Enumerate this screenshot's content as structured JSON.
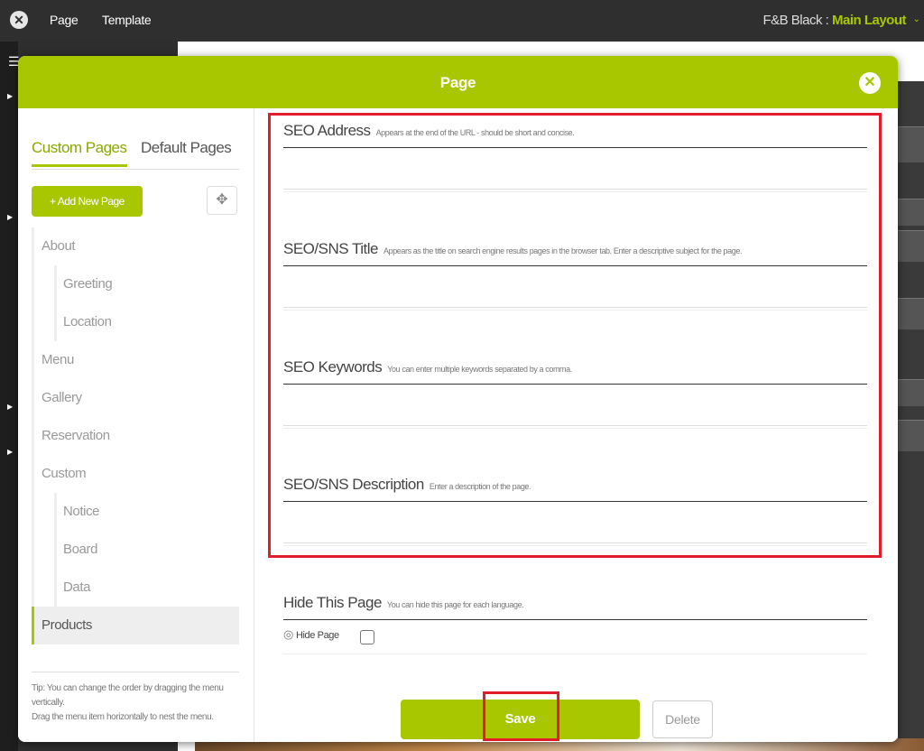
{
  "topbar": {
    "tab_page": "Page",
    "tab_template": "Template",
    "layout_prefix": "F&B Black : ",
    "layout_name": "Main Layout"
  },
  "modal": {
    "title": "Page",
    "close_glyph": "✕"
  },
  "left_panel": {
    "tab_custom": "Custom Pages",
    "tab_default": "Default Pages",
    "add_button": "+ Add New Page",
    "items": [
      {
        "label": "About",
        "level": 0
      },
      {
        "label": "Greeting",
        "level": 1
      },
      {
        "label": "Location",
        "level": 1
      },
      {
        "label": "Menu",
        "level": 0
      },
      {
        "label": "Gallery",
        "level": 0
      },
      {
        "label": "Reservation",
        "level": 0
      },
      {
        "label": "Custom",
        "level": 0
      },
      {
        "label": "Notice",
        "level": 1
      },
      {
        "label": "Board",
        "level": 1
      },
      {
        "label": "Data",
        "level": 1
      },
      {
        "label": "Products",
        "level": 0,
        "active": true
      }
    ],
    "tip_line1": "Tip: You can change the order by dragging the menu vertically.",
    "tip_line2": "Drag the menu item horizontally to nest the menu."
  },
  "fields": {
    "seo_address": {
      "label": "SEO Address",
      "hint": "Appears at the end of the URL - should be short and concise.",
      "value": ""
    },
    "seo_title": {
      "label": "SEO/SNS Title",
      "hint": "Appears as the title on search engine results pages in the browser tab. Enter a descriptive subject for the page.",
      "value": ""
    },
    "seo_keywords": {
      "label": "SEO Keywords",
      "hint": "You can enter multiple keywords separated by a comma.",
      "value": ""
    },
    "seo_description": {
      "label": "SEO/SNS Description",
      "hint": "Enter a description of the page.",
      "value": ""
    }
  },
  "hide": {
    "label": "Hide This Page",
    "hint": "You can hide this page for each language.",
    "toggle_label": "Hide Page",
    "checked": false
  },
  "actions": {
    "save": "Save",
    "delete": "Delete"
  },
  "colors": {
    "accent": "#a8c700",
    "highlight": "#e11d2b"
  },
  "icons": {
    "close": "close-icon",
    "move": "move-icon",
    "eye": "eye-hidden-icon"
  }
}
